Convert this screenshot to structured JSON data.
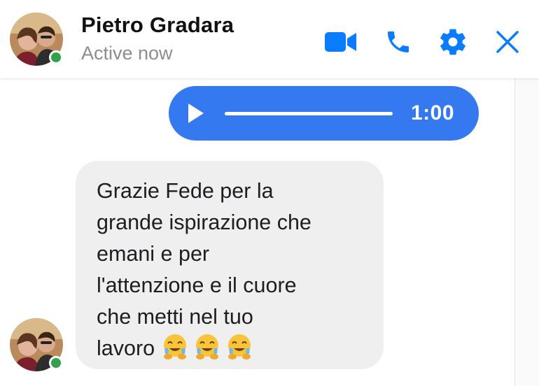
{
  "header": {
    "contact_name": "Pietro Gradara",
    "status": "Active now",
    "actions": [
      {
        "name": "video-call",
        "icon": "video-camera-icon"
      },
      {
        "name": "voice-call",
        "icon": "phone-icon"
      },
      {
        "name": "settings",
        "icon": "gear-icon"
      },
      {
        "name": "close",
        "icon": "close-icon"
      }
    ]
  },
  "colors": {
    "accent": "#0a7cff",
    "bubble_outgoing": "#3579f1",
    "bubble_incoming": "#efefef",
    "presence": "#31a24c"
  },
  "messages": {
    "audio": {
      "duration": "1:00",
      "icon": "play-icon"
    },
    "text": {
      "body": "Grazie Fede per la\ngrande ispirazione che\nemani e per\nl'attenzione e il cuore\nche metti nel tuo\nlavoro",
      "emojis": [
        "tears-of-joy-hug-emoji",
        "tears-of-joy-hug-emoji",
        "tears-of-joy-hug-emoji"
      ]
    }
  }
}
